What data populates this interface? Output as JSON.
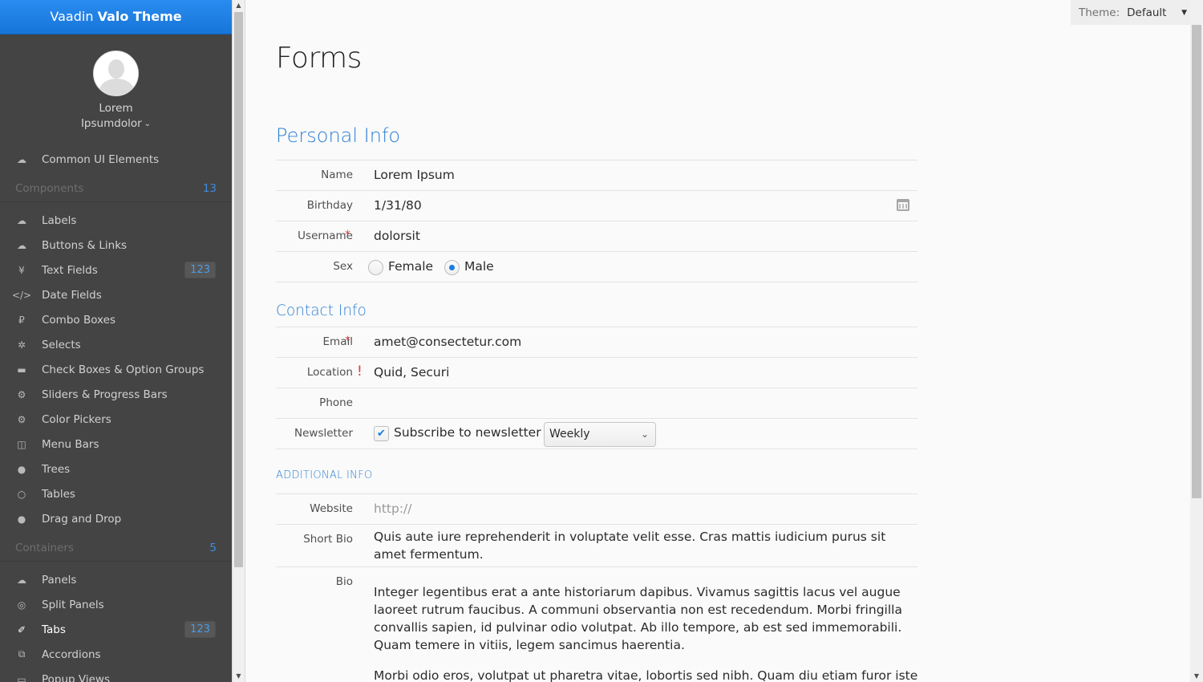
{
  "sidebar": {
    "brand_prefix": "Vaadin",
    "brand_name": "Valo Theme",
    "user": {
      "line1": "Lorem",
      "line2": "Ipsumdolor",
      "chevron": "⌄"
    },
    "items": [
      {
        "label": "Common UI Elements",
        "icon": "☁",
        "icon_name": "cloud-icon"
      },
      {
        "label": "Labels",
        "icon": "☁",
        "icon_name": "cloud-upload-icon"
      },
      {
        "label": "Buttons & Links",
        "icon": "☁",
        "icon_name": "cloud-download-icon"
      },
      {
        "label": "Text Fields",
        "icon": "¥",
        "icon_name": "yen-icon",
        "badge": "123"
      },
      {
        "label": "Date Fields",
        "icon": "</>",
        "icon_name": "code-icon"
      },
      {
        "label": "Combo Boxes",
        "icon": "₽",
        "icon_name": "ruble-icon"
      },
      {
        "label": "Selects",
        "icon": "✲",
        "icon_name": "life-ring-icon"
      },
      {
        "label": "Check Boxes & Option Groups",
        "icon": "▬",
        "icon_name": "truck-icon"
      },
      {
        "label": "Sliders & Progress Bars",
        "icon": "⚙",
        "icon_name": "gear-icon"
      },
      {
        "label": "Color Pickers",
        "icon": "⚙",
        "icon_name": "gears-icon"
      },
      {
        "label": "Menu Bars",
        "icon": "◫",
        "icon_name": "columns-icon"
      },
      {
        "label": "Trees",
        "icon": "●",
        "icon_name": "comment-icon"
      },
      {
        "label": "Tables",
        "icon": "○",
        "icon_name": "comment-outline-icon"
      },
      {
        "label": "Drag and Drop",
        "icon": "●",
        "icon_name": "comments-icon"
      },
      {
        "label": "Panels",
        "icon": "☁",
        "icon_name": "cloud-upload-icon"
      },
      {
        "label": "Split Panels",
        "icon": "◎",
        "icon_name": "compass-icon"
      },
      {
        "label": "Tabs",
        "icon": "✐",
        "icon_name": "thumb-tack-icon",
        "badge": "123",
        "active": true
      },
      {
        "label": "Accordions",
        "icon": "⧉",
        "icon_name": "copy-icon"
      },
      {
        "label": "Popup Views",
        "icon": "▭",
        "icon_name": "credit-card-icon"
      }
    ],
    "sections": [
      {
        "label": "Components",
        "count": "13"
      },
      {
        "label": "Containers",
        "count": "5"
      }
    ]
  },
  "theme_picker": {
    "label": "Theme:",
    "value": "Default",
    "arrow": "▼"
  },
  "page": {
    "title": "Forms",
    "personal_title": "Personal Info",
    "contact_title": "Contact Info",
    "additional_title": "ADDITIONAL INFO"
  },
  "form": {
    "name_label": "Name",
    "name_value": "Lorem Ipsum",
    "birthday_label": "Birthday",
    "birthday_value": "1/31/80",
    "username_label": "Username",
    "username_value": "dolorsit",
    "sex_label": "Sex",
    "sex_female": "Female",
    "sex_male": "Male",
    "email_label": "Email",
    "email_value": "amet@consectetur.com",
    "location_label": "Location",
    "location_value": "Quid, Securi",
    "phone_label": "Phone",
    "phone_value": "",
    "newsletter_label": "Newsletter",
    "newsletter_check": "Subscribe to newsletter",
    "newsletter_freq": "Weekly",
    "website_label": "Website",
    "website_placeholder": "http://",
    "shortbio_label": "Short Bio",
    "shortbio_value": "Quis aute iure reprehenderit in voluptate velit esse. Cras mattis iudicium purus sit amet fermentum.",
    "bio_label": "Bio",
    "bio_p1": "Integer legentibus erat a ante historiarum dapibus. Vivamus sagittis lacus vel augue laoreet rutrum faucibus. A communi observantia non est recedendum. Morbi fringilla convallis sapien, id pulvinar odio volutpat. Ab illo tempore, ab est sed immemorabili. Quam temere in vitiis, legem sancimus haerentia.",
    "bio_p2": "Morbi odio eros, volutpat ut pharetra vitae, lobortis sed nibh. Quam diu etiam furor iste",
    "required_mark": "*",
    "error_mark": "!",
    "check_mark": "✔",
    "dropdown_arrow": "⌄"
  },
  "colors": {
    "accent": "#197de1",
    "sidebar_bg": "#444444",
    "required": "#e23a3a"
  }
}
